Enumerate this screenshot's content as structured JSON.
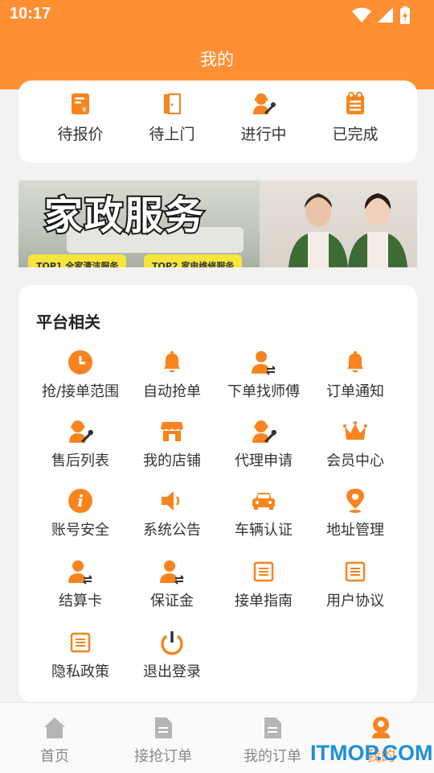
{
  "status_bar": {
    "time": "10:17"
  },
  "header": {
    "title": "我的"
  },
  "orders": [
    {
      "label": "待报价",
      "icon": "quote-doc-icon"
    },
    {
      "label": "待上门",
      "icon": "door-icon"
    },
    {
      "label": "进行中",
      "icon": "worker-wrench-icon"
    },
    {
      "label": "已完成",
      "icon": "clipboard-icon"
    }
  ],
  "banner": {
    "title": "家政服务",
    "tag1": "TOP1 全家清洁服务",
    "tag2": "TOP2 家电维修服务"
  },
  "platform": {
    "heading": "平台相关",
    "items": [
      {
        "label": "抢/接单范围",
        "icon": "clock-icon"
      },
      {
        "label": "自动抢单",
        "icon": "bell-icon"
      },
      {
        "label": "下单找师傅",
        "icon": "user-swap-icon"
      },
      {
        "label": "订单通知",
        "icon": "bell-icon"
      },
      {
        "label": "售后列表",
        "icon": "worker-wrench-icon"
      },
      {
        "label": "我的店铺",
        "icon": "shop-icon"
      },
      {
        "label": "代理申请",
        "icon": "worker-wrench-icon"
      },
      {
        "label": "会员中心",
        "icon": "crown-icon"
      },
      {
        "label": "账号安全",
        "icon": "info-icon"
      },
      {
        "label": "系统公告",
        "icon": "speaker-icon"
      },
      {
        "label": "车辆认证",
        "icon": "car-icon"
      },
      {
        "label": "地址管理",
        "icon": "location-pin-icon"
      },
      {
        "label": "结算卡",
        "icon": "user-swap-icon"
      },
      {
        "label": "保证金",
        "icon": "user-swap-icon"
      },
      {
        "label": "接单指南",
        "icon": "document-icon"
      },
      {
        "label": "用户协议",
        "icon": "document-icon"
      },
      {
        "label": "隐私政策",
        "icon": "document-icon"
      },
      {
        "label": "退出登录",
        "icon": "power-icon"
      }
    ]
  },
  "tabbar": [
    {
      "label": "首页",
      "icon": "home-icon",
      "active": false
    },
    {
      "label": "接抢订单",
      "icon": "file-icon",
      "active": false
    },
    {
      "label": "我的订单",
      "icon": "file-icon",
      "active": false
    },
    {
      "label": "我的",
      "icon": "user-icon",
      "active": true
    }
  ],
  "watermark": "ITMOP.COM",
  "colors": {
    "accent": "#ff8f33",
    "background": "#f2f2f2",
    "card": "#ffffff",
    "icon_orange": "#f7841f"
  }
}
